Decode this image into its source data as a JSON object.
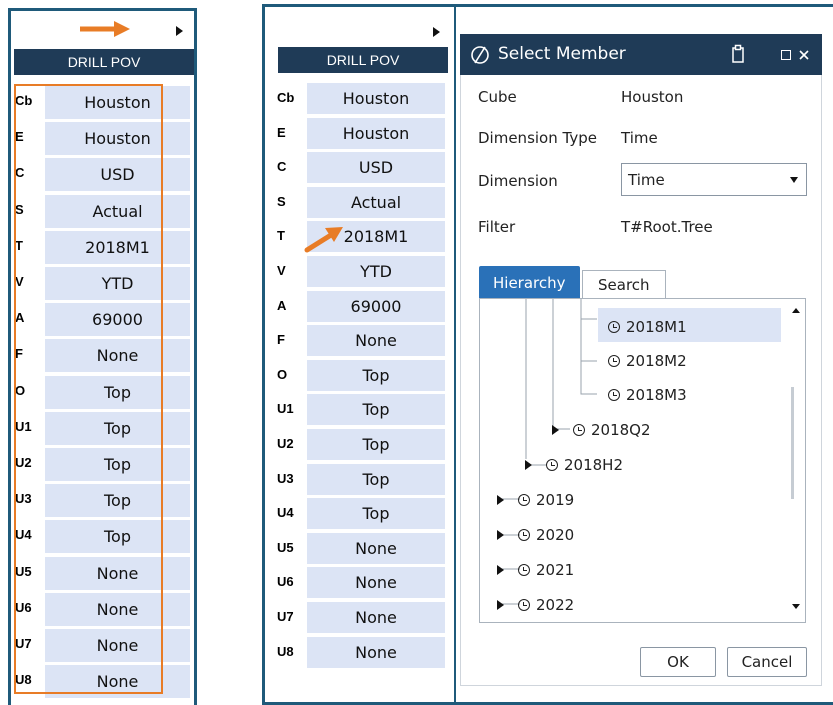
{
  "left_panel": {
    "header": "DRILL POV",
    "rows": [
      {
        "code": "Cb",
        "value": "Houston"
      },
      {
        "code": "E",
        "value": "Houston"
      },
      {
        "code": "C",
        "value": "USD"
      },
      {
        "code": "S",
        "value": "Actual"
      },
      {
        "code": "T",
        "value": "2018M1"
      },
      {
        "code": "V",
        "value": "YTD"
      },
      {
        "code": "A",
        "value": "69000"
      },
      {
        "code": "F",
        "value": "None"
      },
      {
        "code": "O",
        "value": "Top"
      },
      {
        "code": "U1",
        "value": "Top"
      },
      {
        "code": "U2",
        "value": "Top"
      },
      {
        "code": "U3",
        "value": "Top"
      },
      {
        "code": "U4",
        "value": "Top"
      },
      {
        "code": "U5",
        "value": "None"
      },
      {
        "code": "U6",
        "value": "None"
      },
      {
        "code": "U7",
        "value": "None"
      },
      {
        "code": "U8",
        "value": "None"
      }
    ]
  },
  "right_panel": {
    "header": "DRILL POV",
    "rows": [
      {
        "code": "Cb",
        "value": "Houston"
      },
      {
        "code": "E",
        "value": "Houston"
      },
      {
        "code": "C",
        "value": "USD"
      },
      {
        "code": "S",
        "value": "Actual"
      },
      {
        "code": "T",
        "value": "2018M1"
      },
      {
        "code": "V",
        "value": "YTD"
      },
      {
        "code": "A",
        "value": "69000"
      },
      {
        "code": "F",
        "value": "None"
      },
      {
        "code": "O",
        "value": "Top"
      },
      {
        "code": "U1",
        "value": "Top"
      },
      {
        "code": "U2",
        "value": "Top"
      },
      {
        "code": "U3",
        "value": "Top"
      },
      {
        "code": "U4",
        "value": "Top"
      },
      {
        "code": "U5",
        "value": "None"
      },
      {
        "code": "U6",
        "value": "None"
      },
      {
        "code": "U7",
        "value": "None"
      },
      {
        "code": "U8",
        "value": "None"
      }
    ]
  },
  "dialog": {
    "title": "Select Member",
    "fields": {
      "cube_label": "Cube",
      "cube_value": "Houston",
      "dimtype_label": "Dimension Type",
      "dimtype_value": "Time",
      "dimension_label": "Dimension",
      "dimension_value": "Time",
      "filter_label": "Filter",
      "filter_value": "T#Root.Tree"
    },
    "tabs": [
      "Hierarchy",
      "Search"
    ],
    "tree": {
      "months": [
        "2018M1",
        "2018M2",
        "2018M3"
      ],
      "quarter": "2018Q2",
      "half": "2018H2",
      "years": [
        "2019",
        "2020",
        "2021",
        "2022"
      ]
    },
    "ok_label": "OK",
    "cancel_label": "Cancel"
  },
  "colors": {
    "header_navy": "#1f3b57",
    "cell_blue": "#dce4f5",
    "frame_teal": "#1f5a7a",
    "annotation_orange": "#e87c26",
    "tab_blue": "#2a71b8"
  }
}
